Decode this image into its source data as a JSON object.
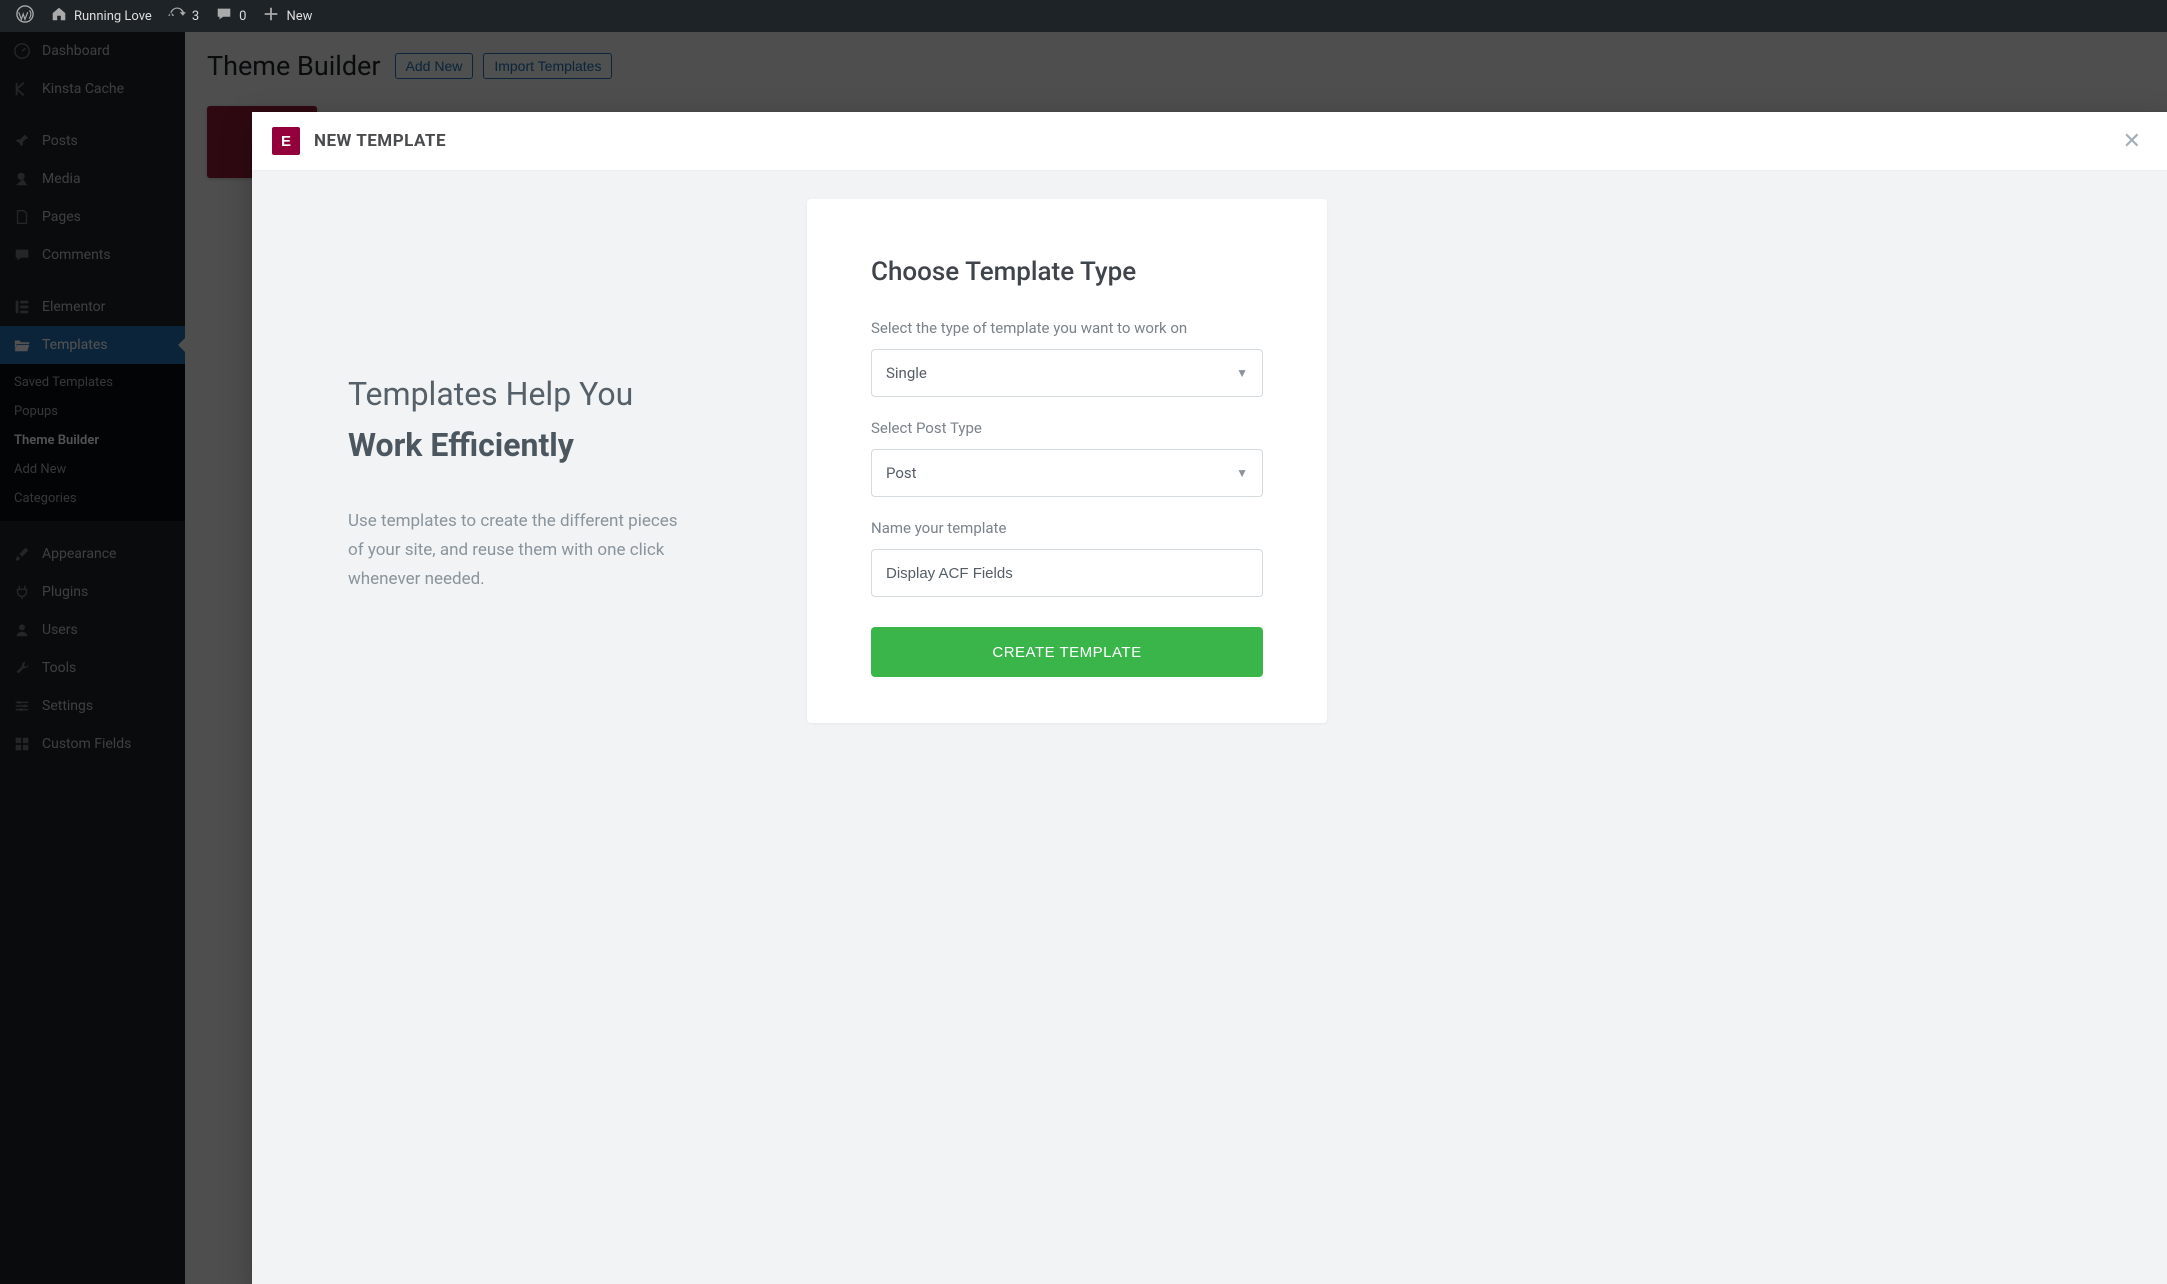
{
  "adminbar": {
    "site_name": "Running Love",
    "updates_count": "3",
    "comments_count": "0",
    "new_label": "New"
  },
  "sidebar": {
    "items": [
      {
        "name": "dashboard",
        "label": "Dashboard"
      },
      {
        "name": "kinsta-cache",
        "label": "Kinsta Cache"
      },
      {
        "name": "posts",
        "label": "Posts"
      },
      {
        "name": "media",
        "label": "Media"
      },
      {
        "name": "pages",
        "label": "Pages"
      },
      {
        "name": "comments",
        "label": "Comments"
      },
      {
        "name": "elementor",
        "label": "Elementor"
      },
      {
        "name": "templates",
        "label": "Templates"
      },
      {
        "name": "appearance",
        "label": "Appearance"
      },
      {
        "name": "plugins",
        "label": "Plugins"
      },
      {
        "name": "users",
        "label": "Users"
      },
      {
        "name": "tools",
        "label": "Tools"
      },
      {
        "name": "settings",
        "label": "Settings"
      },
      {
        "name": "custom-fields",
        "label": "Custom Fields"
      }
    ],
    "submenu": {
      "saved_templates": "Saved Templates",
      "popups": "Popups",
      "theme_builder": "Theme Builder",
      "add_new": "Add New",
      "categories": "Categories"
    }
  },
  "page": {
    "title": "Theme Builder",
    "add_new": "Add New",
    "import": "Import Templates"
  },
  "modal": {
    "title": "NEW TEMPLATE",
    "left_heading_1": "Templates Help You",
    "left_heading_2": "Work Efficiently",
    "left_desc": "Use templates to create the different pieces of your site, and reuse them with one click whenever needed.",
    "form": {
      "heading": "Choose Template Type",
      "type_label": "Select the type of template you want to work on",
      "type_value": "Single",
      "post_type_label": "Select Post Type",
      "post_type_value": "Post",
      "name_label": "Name your template",
      "name_value": "Display ACF Fields",
      "submit_label": "CREATE TEMPLATE"
    }
  }
}
